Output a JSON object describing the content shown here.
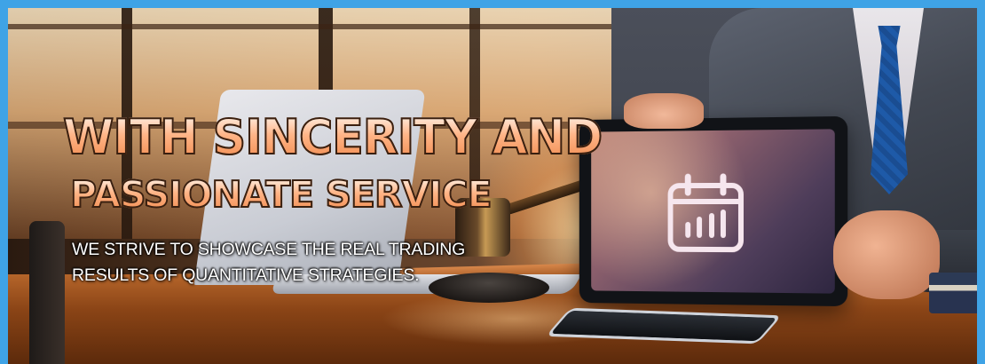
{
  "banner": {
    "headline_line1": "WITH SINCERITY AND",
    "headline_line2": "PASSIONATE SERVICE",
    "subtext_line1": "WE STRIVE TO SHOWCASE THE REAL TRADING",
    "subtext_line2": "RESULTS OF QUANTITATIVE STRATEGIES."
  },
  "scene": {
    "objects": [
      "laptop",
      "gavel",
      "tablet",
      "smartphone",
      "businessman",
      "books",
      "desk"
    ],
    "tablet_icon": "calendar-chart-icon",
    "colors": {
      "frame": "#3fa3e6",
      "headline_fill_top": "#fff4ea",
      "headline_fill_bottom": "#f08a4e",
      "subtext": "#ffffff",
      "tie": "#1e5aa8"
    }
  }
}
